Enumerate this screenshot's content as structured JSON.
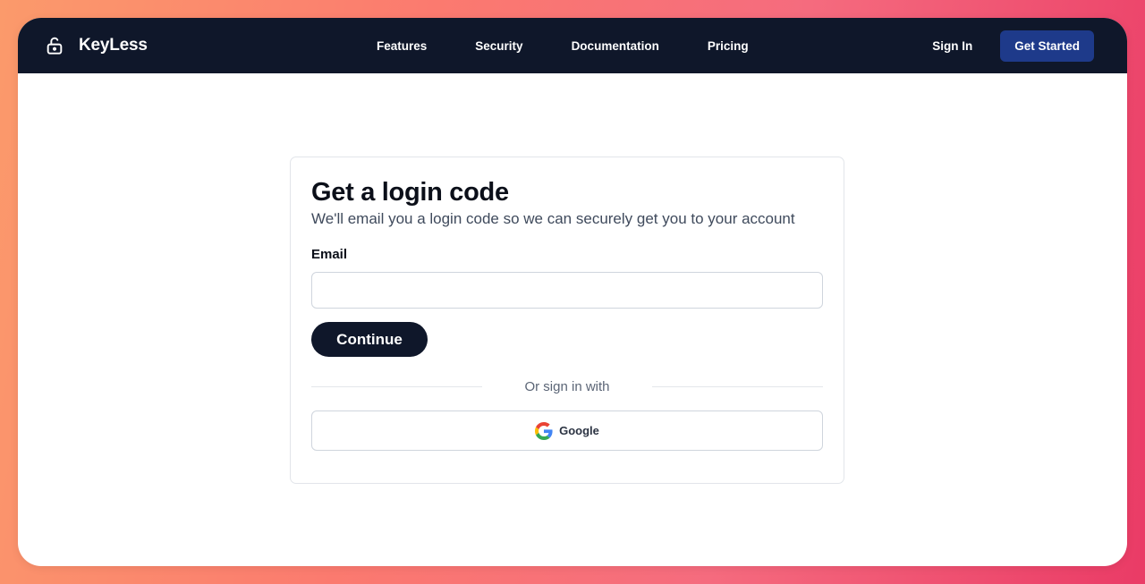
{
  "brand": {
    "name": "KeyLess",
    "icon": "unlock-icon"
  },
  "nav": {
    "links": [
      "Features",
      "Security",
      "Documentation",
      "Pricing"
    ],
    "sign_in": "Sign In",
    "get_started": "Get Started"
  },
  "login": {
    "title": "Get a login code",
    "subtitle": "We'll email you a login code so we can securely get you to your account",
    "email_label": "Email",
    "email_value": "",
    "email_placeholder": "",
    "continue_label": "Continue",
    "divider_text": "Or sign in with",
    "google_label": "Google",
    "google_icon": "google-icon"
  },
  "colors": {
    "navbar_bg": "#0f172a",
    "primary_button": "#1e3a8a",
    "dark_button": "#0f172a"
  }
}
